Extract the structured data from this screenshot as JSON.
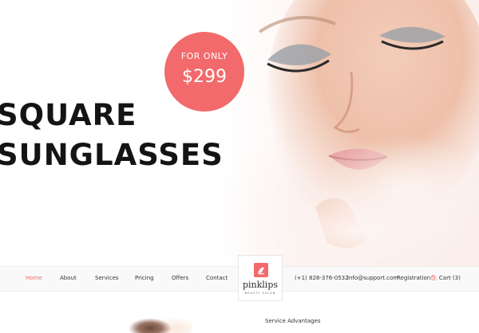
{
  "hero": {
    "headline_line1": "SQUARE",
    "headline_line2": "SUNGLASSES",
    "badge_label": "FOR ONLY",
    "badge_price": "$299"
  },
  "nav": {
    "items": [
      {
        "label": "Home",
        "active": true
      },
      {
        "label": "About"
      },
      {
        "label": "Services"
      },
      {
        "label": "Pricing"
      },
      {
        "label": "Offers"
      },
      {
        "label": "Contact"
      }
    ],
    "logo_name": "pinklips",
    "logo_tagline": "BEAUTY SALON",
    "phone": "(+1) 828-376-0532",
    "email": "info@support.com",
    "registration": "Registration",
    "cart": "Cart (3)"
  },
  "section": {
    "heading": "Service Advantages"
  },
  "colors": {
    "accent": "#f26a6c",
    "text": "#141414",
    "navbar_bg": "#f9f9fa"
  }
}
